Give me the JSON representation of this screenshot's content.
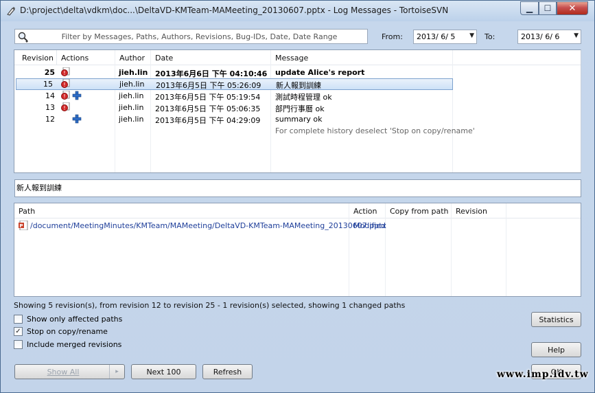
{
  "window": {
    "title": "D:\\project\\delta\\vdkm\\doc...\\DeltaVD-KMTeam-MAMeeting_20130607.pptx - Log Messages - TortoiseSVN",
    "min_glyph": "▁",
    "max_glyph": "☐",
    "close_glyph": "✕"
  },
  "filter": {
    "placeholder": "Filter by Messages, Paths, Authors, Revisions, Bug-IDs, Date, Date Range",
    "from_label": "From:",
    "from_value": "2013/  6/  5",
    "to_label": "To:",
    "to_value": "2013/  6/  6"
  },
  "revisions": {
    "headers": [
      "Revision",
      "Actions",
      "Author",
      "Date",
      "Message"
    ],
    "rows": [
      {
        "revision": "25",
        "author": "jieh.lin",
        "date": "2013年6月6日 下午 04:10:46",
        "message": "update Alice's report"
      },
      {
        "revision": "15",
        "author": "jieh.lin",
        "date": "2013年6月5日 下午 05:26:09",
        "message": "新人報到訓練"
      },
      {
        "revision": "14",
        "author": "jieh.lin",
        "date": "2013年6月5日 下午 05:19:54",
        "message": "測試時程管理 ok"
      },
      {
        "revision": "13",
        "author": "jieh.lin",
        "date": "2013年6月5日 下午 05:06:35",
        "message": "部門行事曆 ok"
      },
      {
        "revision": "12",
        "author": "jieh.lin",
        "date": "2013年6月5日 下午 04:29:09",
        "message": "summary ok"
      }
    ],
    "hint": "For complete history deselect 'Stop on copy/rename'"
  },
  "message_detail": "新人報到訓練",
  "paths": {
    "headers": [
      "Path",
      "Action",
      "Copy from path",
      "Revision"
    ],
    "rows": [
      {
        "path": "/document/MeetingMinutes/KMTeam/MAMeeting/DeltaVD-KMTeam-MAMeeting_20130607.pptx",
        "action": "Modified",
        "copy_from": "",
        "revision": ""
      }
    ]
  },
  "status": "Showing 5 revision(s), from revision 12 to revision 25 - 1 revision(s) selected, showing 1 changed paths",
  "options": {
    "show_affected": {
      "label": "Show only affected paths",
      "checked": false,
      "glyph": ""
    },
    "stop_on_copy": {
      "label": "Stop on copy/rename",
      "checked": true,
      "glyph": "✓"
    },
    "include_merged": {
      "label": "Include merged revisions",
      "checked": false,
      "glyph": ""
    }
  },
  "buttons": {
    "show_all": "Show All",
    "show_all_arrow": "▸",
    "next_100": "Next 100",
    "refresh": "Refresh",
    "statistics": "Statistics",
    "help": "Help",
    "ok": "OK"
  },
  "watermark": "www.imp.idv.tw"
}
